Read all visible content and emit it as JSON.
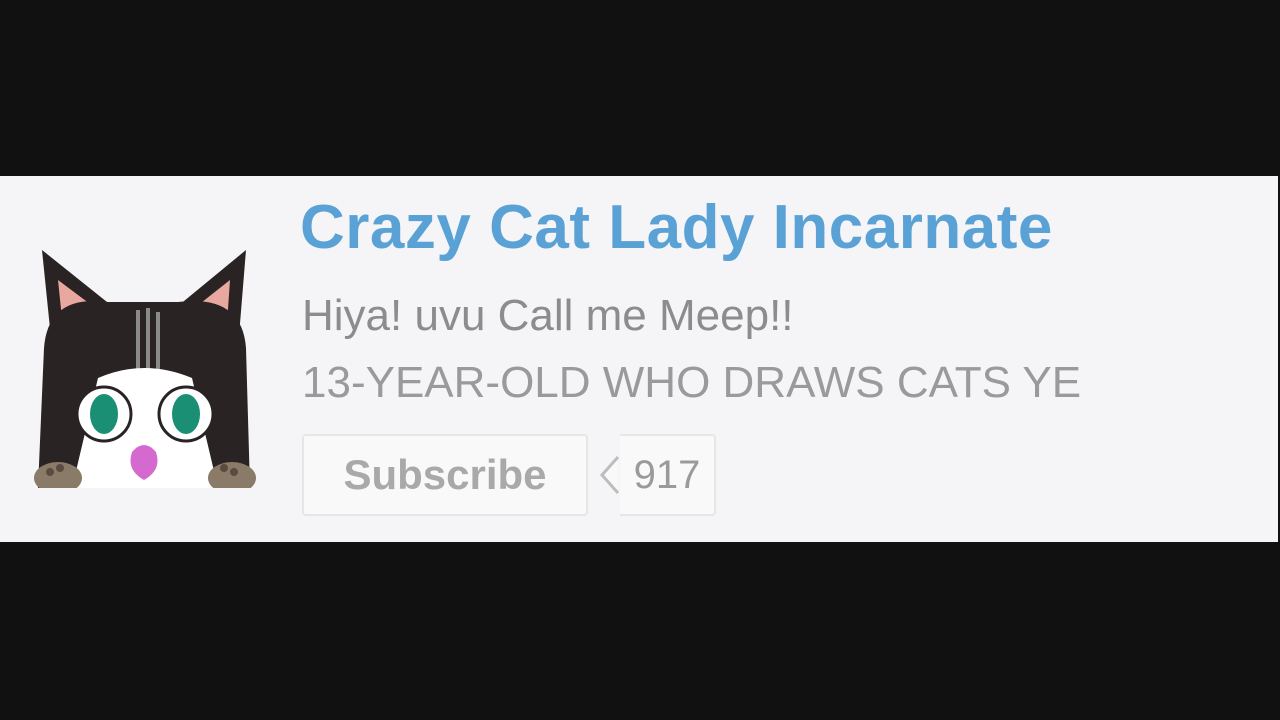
{
  "channel": {
    "name": "Crazy Cat Lady Incarnate",
    "description_line1": "Hiya! uvu Call me Meep!!",
    "description_line2": "13-YEAR-OLD WHO DRAWS CATS YE",
    "avatar_icon": "cat-face-avatar"
  },
  "subscribe": {
    "label": "Subscribe",
    "count": "917"
  },
  "colors": {
    "channel_name": "#5aa2d6",
    "card_background": "#f5f5f7",
    "letterbox": "#111111",
    "text_gray": "#8c8c8c",
    "button_text": "#a9a9a9"
  }
}
